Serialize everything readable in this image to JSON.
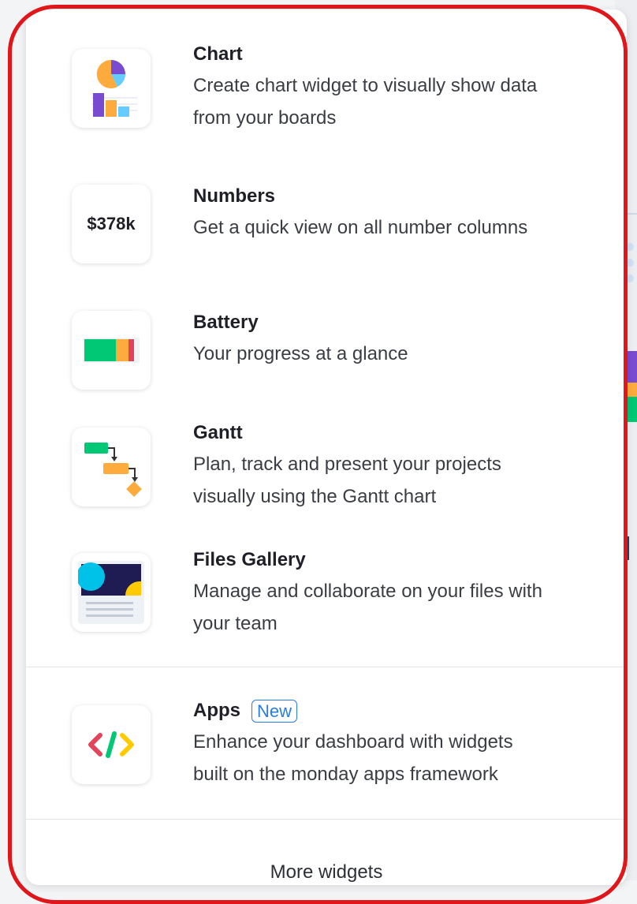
{
  "widgets": [
    {
      "title": "Chart",
      "desc_lines": [
        "Create chart widget to visually show data",
        "from your boards"
      ],
      "icon": "chart-icon"
    },
    {
      "title": "Numbers",
      "desc_lines": [
        "Get a quick view on all number columns"
      ],
      "icon": "numbers-icon",
      "icon_text": "$378k"
    },
    {
      "title": "Battery",
      "desc_lines": [
        "Your progress at a glance"
      ],
      "icon": "battery-icon"
    },
    {
      "title": "Gantt",
      "desc_lines": [
        "Plan, track and present your projects",
        "visually using the Gantt chart"
      ],
      "icon": "gantt-icon"
    },
    {
      "title": "Files Gallery",
      "desc_lines": [
        "Manage and collaborate on your files with",
        "your team"
      ],
      "icon": "files-gallery-icon"
    },
    {
      "title": "Apps",
      "badge": "New",
      "desc_lines": [
        "Enhance your dashboard with widgets",
        "built on the monday apps framework"
      ],
      "icon": "apps-code-icon"
    }
  ],
  "footer": {
    "more_label": "More widgets"
  },
  "colors": {
    "highlight_border": "#e0161a",
    "badge_blue": "#2a7de1",
    "battery_green": "#00c875",
    "battery_orange": "#fdab3d",
    "battery_red": "#e2445c",
    "chart_purple": "#784bd1",
    "gallery_navy": "#1f1c54",
    "gallery_cyan": "#00c2e8",
    "gallery_yellow": "#ffcb00"
  }
}
